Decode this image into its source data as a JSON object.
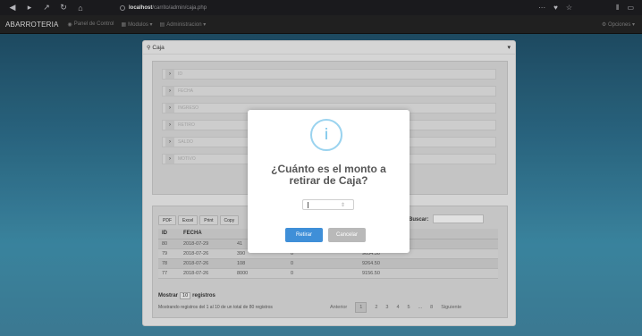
{
  "browser": {
    "url_host": "localhost",
    "url_path": "/carrito/admin/caja.php",
    "nav_icons": [
      "back-icon",
      "forward-icon",
      "up-icon",
      "reload-icon",
      "home-icon"
    ]
  },
  "navbar": {
    "brand": "ABARROTERIA",
    "items": [
      {
        "icon": "dashboard-icon",
        "label": "Panel de Control"
      },
      {
        "icon": "modules-icon",
        "label": "Modulos ▾"
      },
      {
        "icon": "admin-icon",
        "label": "Administracion ▾"
      }
    ],
    "options": "⚙ Opciones ▾"
  },
  "panel": {
    "title": "Caja",
    "fields": [
      "ID",
      "FECHA",
      "INGRESO",
      "RETIRO",
      "SALDO",
      "MOTIVO"
    ]
  },
  "table": {
    "buttons": [
      "PDF",
      "Excel",
      "Print",
      "Copy"
    ],
    "search_label": "Buscar:",
    "headers": [
      "ID",
      "FECHA",
      "",
      "",
      ""
    ],
    "rows": [
      [
        "80",
        "2018-07-29",
        "41",
        "",
        ""
      ],
      [
        "79",
        "2018-07-26",
        "390",
        "0",
        "9654.50"
      ],
      [
        "78",
        "2018-07-26",
        "108",
        "0",
        "9264.50"
      ],
      [
        "77",
        "2018-07-26",
        "8000",
        "0",
        "9156.50"
      ]
    ],
    "show_prefix": "Mostrar",
    "show_value": "10",
    "show_suffix": "registros",
    "info": "Mostrando registros del 1 al 10 de un total de 80 registros",
    "pager": [
      "Anterior",
      "1",
      "2",
      "3",
      "4",
      "5",
      "...",
      "8",
      "Siguiente"
    ],
    "current_page": "1"
  },
  "modal": {
    "icon": "i",
    "title_line1": "¿Cuánto es el monto a",
    "title_line2": "retirar de Caja?",
    "input_value": "",
    "confirm_label": "Retirar",
    "cancel_label": "Cancelar",
    "confirm_color": "#3f8fd8",
    "icon_color": "#6bbfe8"
  }
}
